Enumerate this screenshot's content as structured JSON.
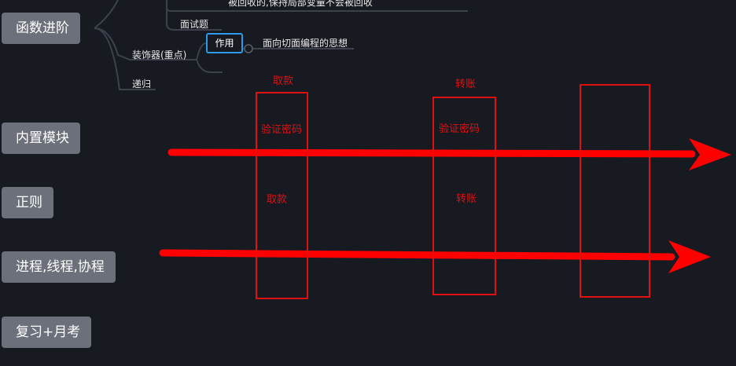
{
  "mindmap": {
    "topics": [
      {
        "label": "函数进阶"
      },
      {
        "label": "内置模块"
      },
      {
        "label": "正则"
      },
      {
        "label": "进程,线程,协程"
      },
      {
        "label": "复习+月考"
      }
    ],
    "subtopics": {
      "closure_note": "被回收的,保持局部变量不会被回收",
      "interview": "面试题",
      "decorator": "装饰器(重点)",
      "recursion": "递归",
      "role_tag": "作用",
      "role_desc": "面向切面编程的思想"
    }
  },
  "annotation": {
    "withdraw_title": "取款",
    "transfer_title": "转账",
    "verify_1": "验证密码",
    "verify_2": "验证密码",
    "withdraw_inner": "取款",
    "transfer_inner": "转账",
    "colors": {
      "red": "#e01010",
      "accent_blue": "#2d9ce8",
      "topic_bg": "#6c707b",
      "background": "#181a22"
    }
  }
}
